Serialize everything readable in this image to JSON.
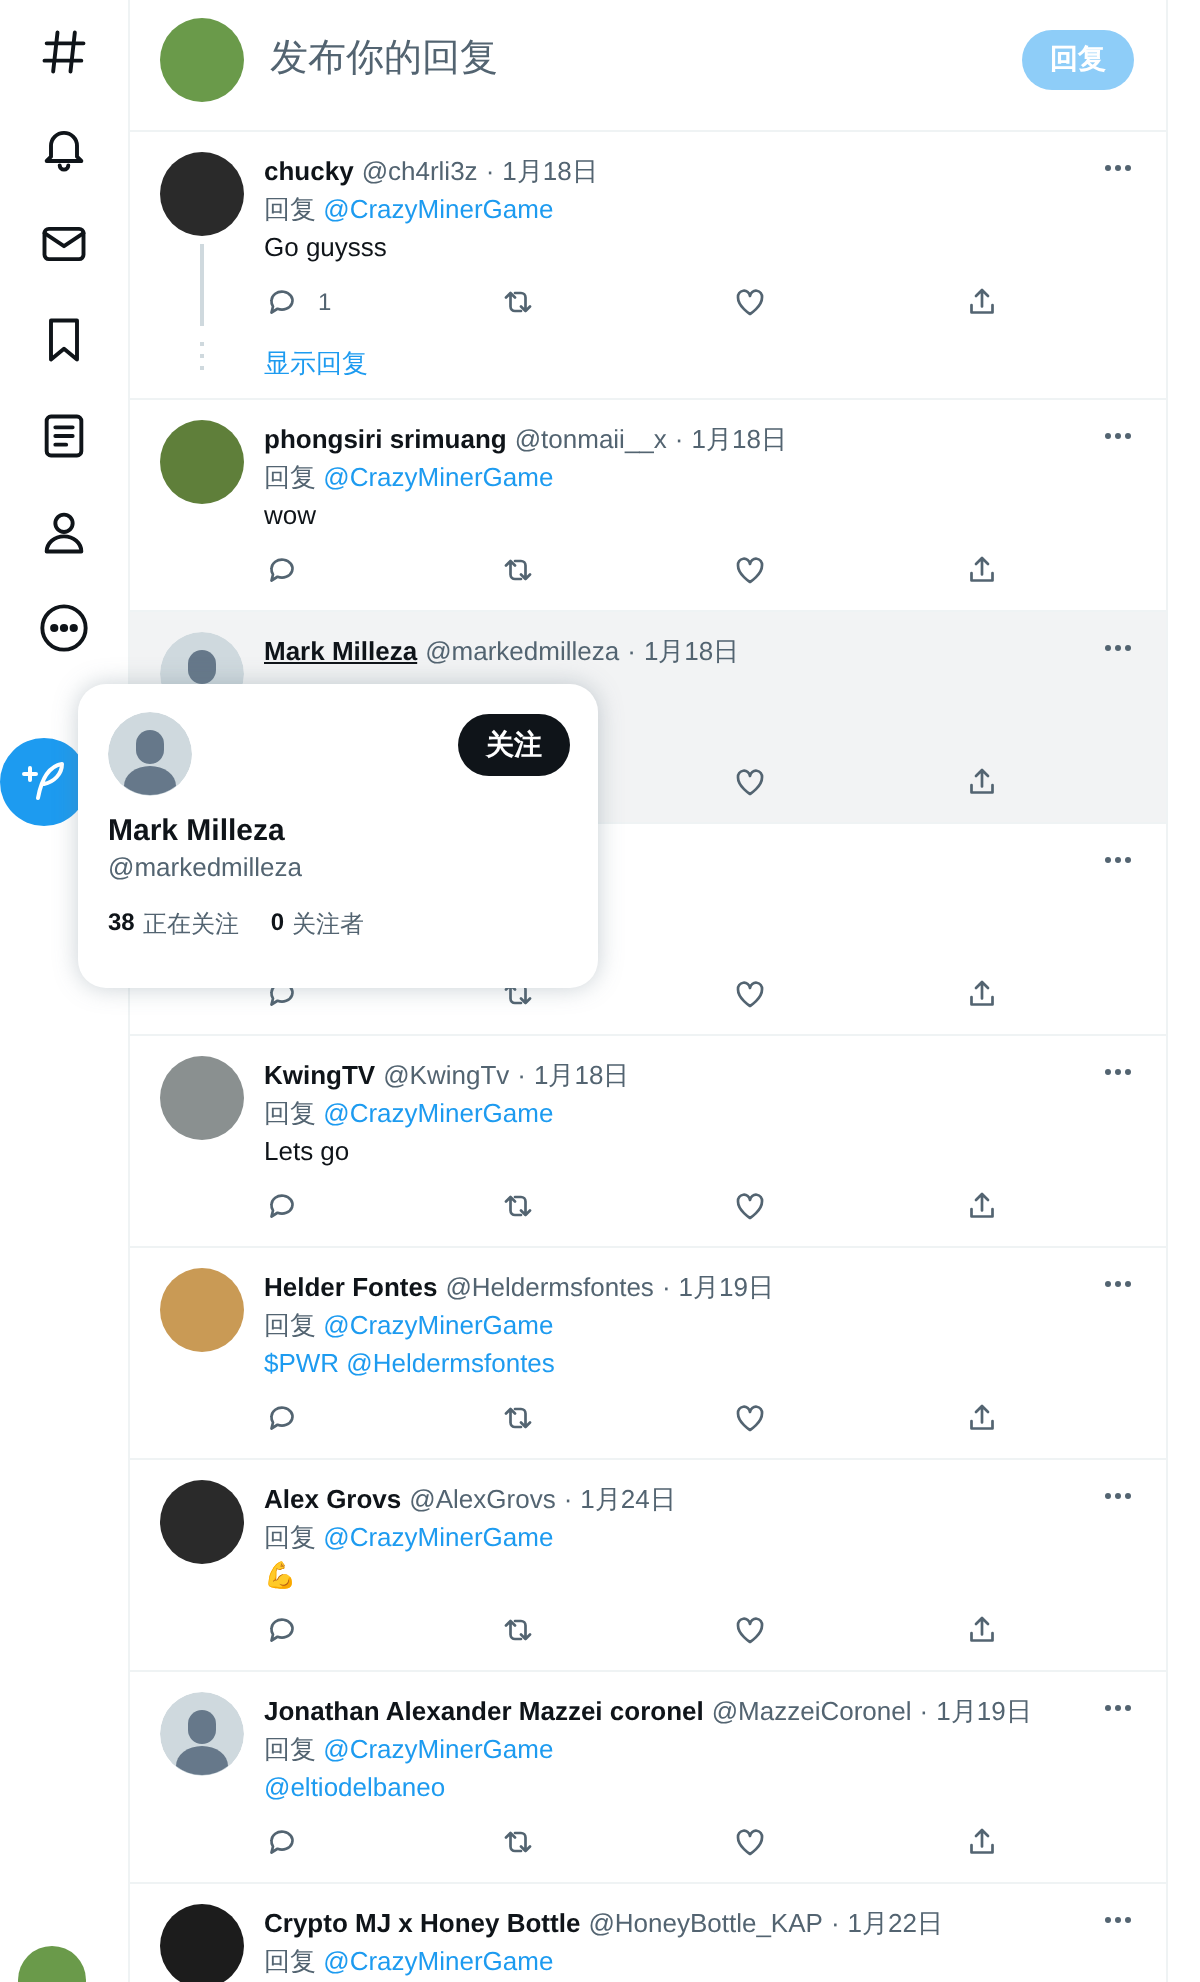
{
  "compose": {
    "placeholder": "发布你的回复",
    "button": {
      "label": "回复",
      "disabled": true
    }
  },
  "tweets": [
    {
      "avatar": {
        "kind": "photo"
      },
      "name": "chucky",
      "handle": "@ch4rli3z",
      "separator": "·",
      "date": "1月18日",
      "reply_prefix": "回复",
      "reply_to": "@CrazyMinerGame",
      "body": {
        "kind": "plain",
        "text": "Go guysss"
      },
      "reply_count": "1",
      "hovered": false,
      "show_replies": "显示回复"
    },
    {
      "avatar": {
        "kind": "photo"
      },
      "name": "phongsiri srimuang",
      "handle": "@tonmaii__x",
      "separator": "·",
      "date": "1月18日",
      "reply_prefix": "回复",
      "reply_to": "@CrazyMinerGame",
      "body": {
        "kind": "plain",
        "text": "wow"
      },
      "hovered": false
    },
    {
      "avatar": {
        "kind": "default"
      },
      "name": "Mark Milleza",
      "handle": "@markedmilleza",
      "separator": "·",
      "date": "1月18日",
      "hovered": true
    },
    {
      "hovered": false
    },
    {
      "avatar": {
        "kind": "photo"
      },
      "name": "KwingTV",
      "handle": "@KwingTv",
      "separator": "·",
      "date": "1月18日",
      "reply_prefix": "回复",
      "reply_to": "@CrazyMinerGame",
      "body": {
        "kind": "plain",
        "text": "Lets go"
      },
      "hovered": false
    },
    {
      "avatar": {
        "kind": "photo"
      },
      "name": "Helder Fontes",
      "handle": "@Heldermsfontes",
      "separator": "·",
      "date": "1月19日",
      "reply_prefix": "回复",
      "reply_to": "@CrazyMinerGame",
      "body": {
        "kind": "link",
        "text": "$PWR @Heldermsfontes"
      },
      "hovered": false
    },
    {
      "avatar": {
        "kind": "photo"
      },
      "name": "Alex Grovs",
      "handle": "@AlexGrovs",
      "separator": "·",
      "date": "1月24日",
      "reply_prefix": "回复",
      "reply_to": "@CrazyMinerGame",
      "body": {
        "kind": "plain",
        "text": "💪"
      },
      "hovered": false
    },
    {
      "avatar": {
        "kind": "default"
      },
      "name": "Jonathan Alexander Mazzei coronel",
      "handle": "@MazzeiCoronel",
      "separator": "·",
      "date": "1月19日",
      "reply_prefix": "回复",
      "reply_to": "@CrazyMinerGame",
      "body": {
        "kind": "link",
        "text": "@eltiodelbaneo"
      },
      "hovered": false
    },
    {
      "avatar": {
        "kind": "photo"
      },
      "name": "Crypto MJ x Honey Bottle",
      "handle": "@HoneyBottle_KAP",
      "separator": "·",
      "date": "1月22日",
      "reply_prefix": "回复",
      "reply_to": "@CrazyMinerGame",
      "hovered": false
    }
  ],
  "hover_card": {
    "name": "Mark Milleza",
    "handle": "@markedmilleza",
    "follow_button": "关注",
    "following_count": "38",
    "following_label": "正在关注",
    "followers_count": "0",
    "followers_label": "关注者"
  }
}
